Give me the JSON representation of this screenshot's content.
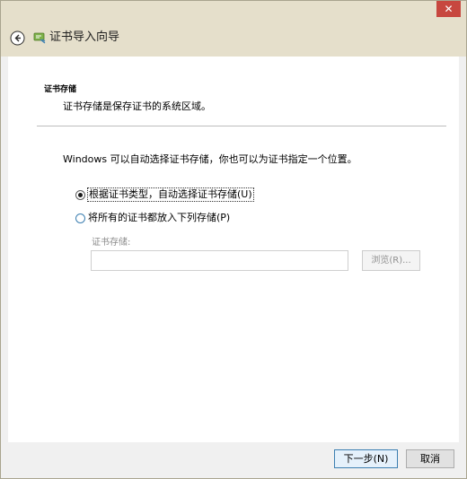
{
  "window": {
    "close_label": "✕",
    "wizard_title": "证书导入向导"
  },
  "section": {
    "title": "证书存储",
    "description": "证书存储是保存证书的系统区域。"
  },
  "intro": "Windows 可以自动选择证书存储，你也可以为证书指定一个位置。",
  "options": [
    {
      "label": "根据证书类型，自动选择证书存储(U)",
      "selected": true
    },
    {
      "label": "将所有的证书都放入下列存储(P)",
      "selected": false
    }
  ],
  "store": {
    "label": "证书存储:",
    "value": "",
    "browse_label": "浏览(R)..."
  },
  "footer": {
    "next_label": "下一步(N)",
    "cancel_label": "取消"
  },
  "colors": {
    "chrome": "#e5dfcb",
    "close": "#c7473f",
    "accent": "#3c7fb1"
  },
  "icons": {
    "back": "back-arrow-icon",
    "wizard": "certificate-icon"
  }
}
